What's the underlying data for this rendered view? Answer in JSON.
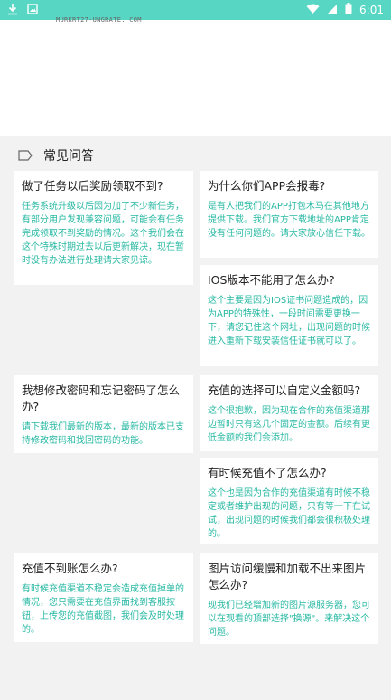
{
  "status_bar": {
    "time": "6:01",
    "left_icons": [
      "download-icon",
      "image-icon"
    ],
    "right_icons": [
      "wifi-icon",
      "signal-icon",
      "battery-icon"
    ]
  },
  "top_partial_text": "MURKRT27-UNGRATE. COM",
  "section_title": "常见问答",
  "colors": {
    "accent": "#27b8a3",
    "status_bar": "#57d6c3",
    "background": "#f2f2f2"
  },
  "faq": [
    {
      "q": "做了任务以后奖励领取不到?",
      "a": "任务系统升级以后因为加了不少新任务，有部分用户发现兼容问题，可能会有任务完成领取不到奖励的情况。这个我们会在这个特殊时期过去以后更新解决，现在暂时没有办法进行处理请大家见谅。"
    },
    {
      "q": "为什么你们APP会报毒?",
      "a": "是有人把我们的APP打包木马在其他地方提供下载。我们官方下载地址的APP肯定没有任何问题的。请大家放心信任下载。"
    },
    {
      "q": "IOS版本不能用了怎么办?",
      "a": "这个主要是因为IOS证书问题造成的，因为APP的特殊性，一段时间需要更换一下，请您记住这个网址，出现问题的时候进入重新下载安装信任证书就可以了。"
    },
    {
      "q": "我想修改密码和忘记密码了怎么办?",
      "a": "请下载我们最新的版本，最新的版本已支持修改密码和找回密码的功能。"
    },
    {
      "q": "充值的选择可以自定义金额吗?",
      "a": "这个很抱歉，因为现在合作的充值渠道那边暂时只有这几个固定的金额。后续有更低金额的我们会添加。"
    },
    {
      "q": "有时候充值不了怎么办?",
      "a": "这个也是因为合作的充值渠道有时候不稳定或者维护出现的问题，只有等一下在试试，出现问题的时候我们都会很积极处理的。"
    },
    {
      "q": "充值不到账怎么办?",
      "a": "有时候充值渠道不稳定会造成充值掉单的情况，您只需要在充值界面找到客服按钮，上传您的充值截图，我们会及时处理的。"
    },
    {
      "q": "图片访问缓慢和加载不出来图片怎么办?",
      "a": "现我们已经增加新的图片源服务器，您可以在观看的顶部选择\"换源\"。来解决这个问题。"
    }
  ]
}
